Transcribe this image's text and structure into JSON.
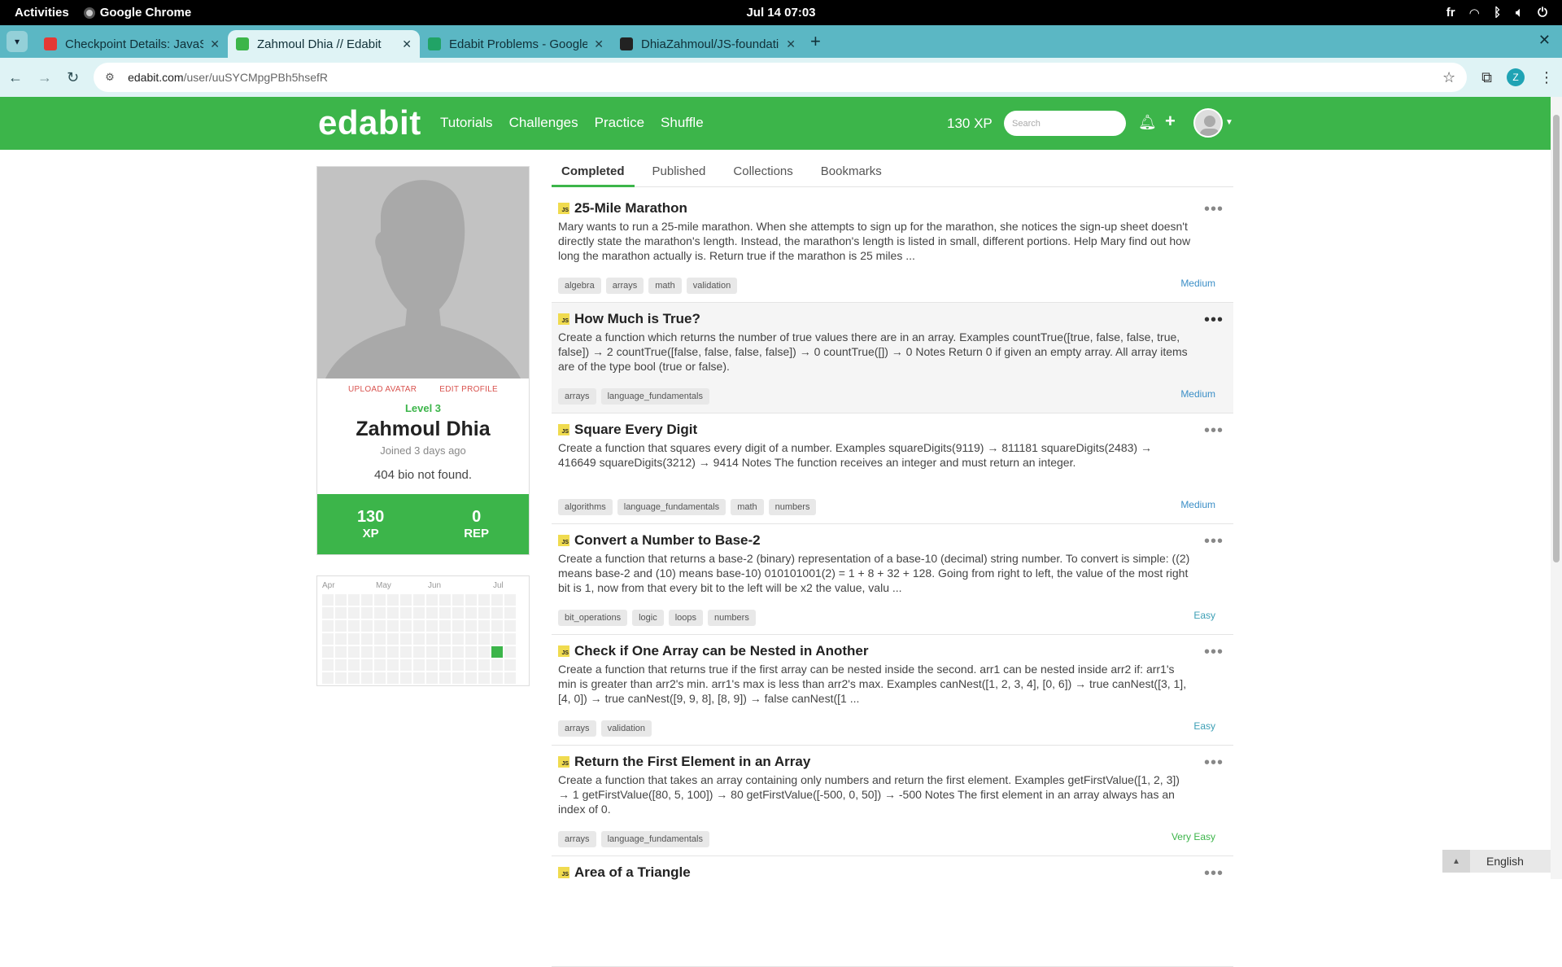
{
  "gnome": {
    "activities": "Activities",
    "app": "Google Chrome",
    "clock": "Jul 14  07:03",
    "lang": "fr"
  },
  "browser": {
    "tabs": [
      {
        "title": "Checkpoint Details: JavaScript",
        "color": "#e53935"
      },
      {
        "title": "Zahmoul Dhia // Edabit",
        "color": "#3cb54a"
      },
      {
        "title": "Edabit Problems - Google",
        "color": "#21a366"
      },
      {
        "title": "DhiaZahmoul/JS-foundations",
        "color": "#222222"
      }
    ],
    "url_host": "edabit.com",
    "url_path": "/user/uuSYCMpgPBh5hsefR",
    "profile_initial": "Z"
  },
  "header": {
    "logo": "edabit",
    "nav": [
      "Tutorials",
      "Challenges",
      "Practice",
      "Shuffle"
    ],
    "xp": "130 XP",
    "search_placeholder": "Search"
  },
  "profile": {
    "upload": "UPLOAD AVATAR",
    "edit": "EDIT PROFILE",
    "level": "Level 3",
    "name": "Zahmoul Dhia",
    "joined": "Joined 3 days ago",
    "bio": "404 bio not found.",
    "xp_value": "130",
    "xp_label": "XP",
    "rep_value": "0",
    "rep_label": "REP"
  },
  "heatmap": {
    "months": [
      "Apr",
      "May",
      "Jun",
      "Jul"
    ]
  },
  "content_tabs": [
    "Completed",
    "Published",
    "Collections",
    "Bookmarks"
  ],
  "challenges": [
    {
      "title": "25-Mile Marathon",
      "desc": "Mary wants to run a 25-mile marathon. When she attempts to sign up for the marathon, she notices the sign-up sheet doesn't directly state the marathon's length. Instead, the marathon's length is listed in small, different portions. Help Mary find out how long the marathon actually is. Return true if the marathon is 25 miles ...",
      "tags": [
        "algebra",
        "arrays",
        "math",
        "validation"
      ],
      "difficulty": "Medium"
    },
    {
      "title": "How Much is True?",
      "desc": "Create a function which returns the number of true values there are in an array. Examples countTrue([true, false, false, true, false]) → 2 countTrue([false, false, false, false]) → 0 countTrue([]) → 0 Notes Return 0 if given an empty array. All array items are of the type bool (true or false).",
      "tags": [
        "arrays",
        "language_fundamentals"
      ],
      "difficulty": "Medium"
    },
    {
      "title": "Square Every Digit",
      "desc": "Create a function that squares every digit of a number. Examples squareDigits(9119) → 811181 squareDigits(2483) → 416649 squareDigits(3212) → 9414 Notes The function receives an integer and must return an integer.",
      "tags": [
        "algorithms",
        "language_fundamentals",
        "math",
        "numbers"
      ],
      "difficulty": "Medium"
    },
    {
      "title": "Convert a Number to Base-2",
      "desc": "Create a function that returns a base-2 (binary) representation of a base-10 (decimal) string number. To convert is simple: ((2) means base-2 and (10) means base-10) 010101001(2) = 1 + 8 + 32 + 128. Going from right to left, the value of the most right bit is 1, now from that every bit to the left will be x2 the value, valu ...",
      "tags": [
        "bit_operations",
        "logic",
        "loops",
        "numbers"
      ],
      "difficulty": "Easy"
    },
    {
      "title": "Check if One Array can be Nested in Another",
      "desc": "Create a function that returns true if the first array can be nested inside the second. arr1 can be nested inside arr2 if: arr1's min is greater than arr2's min. arr1's max is less than arr2's max. Examples canNest([1, 2, 3, 4], [0, 6]) → true canNest([3, 1], [4, 0]) → true canNest([9, 9, 8], [8, 9]) → false canNest([1 ...",
      "tags": [
        "arrays",
        "validation"
      ],
      "difficulty": "Easy"
    },
    {
      "title": "Return the First Element in an Array",
      "desc": "Create a function that takes an array containing only numbers and return the first element. Examples getFirstValue([1, 2, 3]) → 1 getFirstValue([80, 5, 100]) → 80 getFirstValue([-500, 0, 50]) → -500 Notes The first element in an array always has an index of 0.",
      "tags": [
        "arrays",
        "language_fundamentals"
      ],
      "difficulty": "Very Easy"
    },
    {
      "title": "Area of a Triangle",
      "desc": "",
      "tags": [],
      "difficulty": ""
    }
  ],
  "language": "English",
  "colors": {
    "brand": "#3cb54a",
    "tabstrip": "#5bb7c4"
  }
}
